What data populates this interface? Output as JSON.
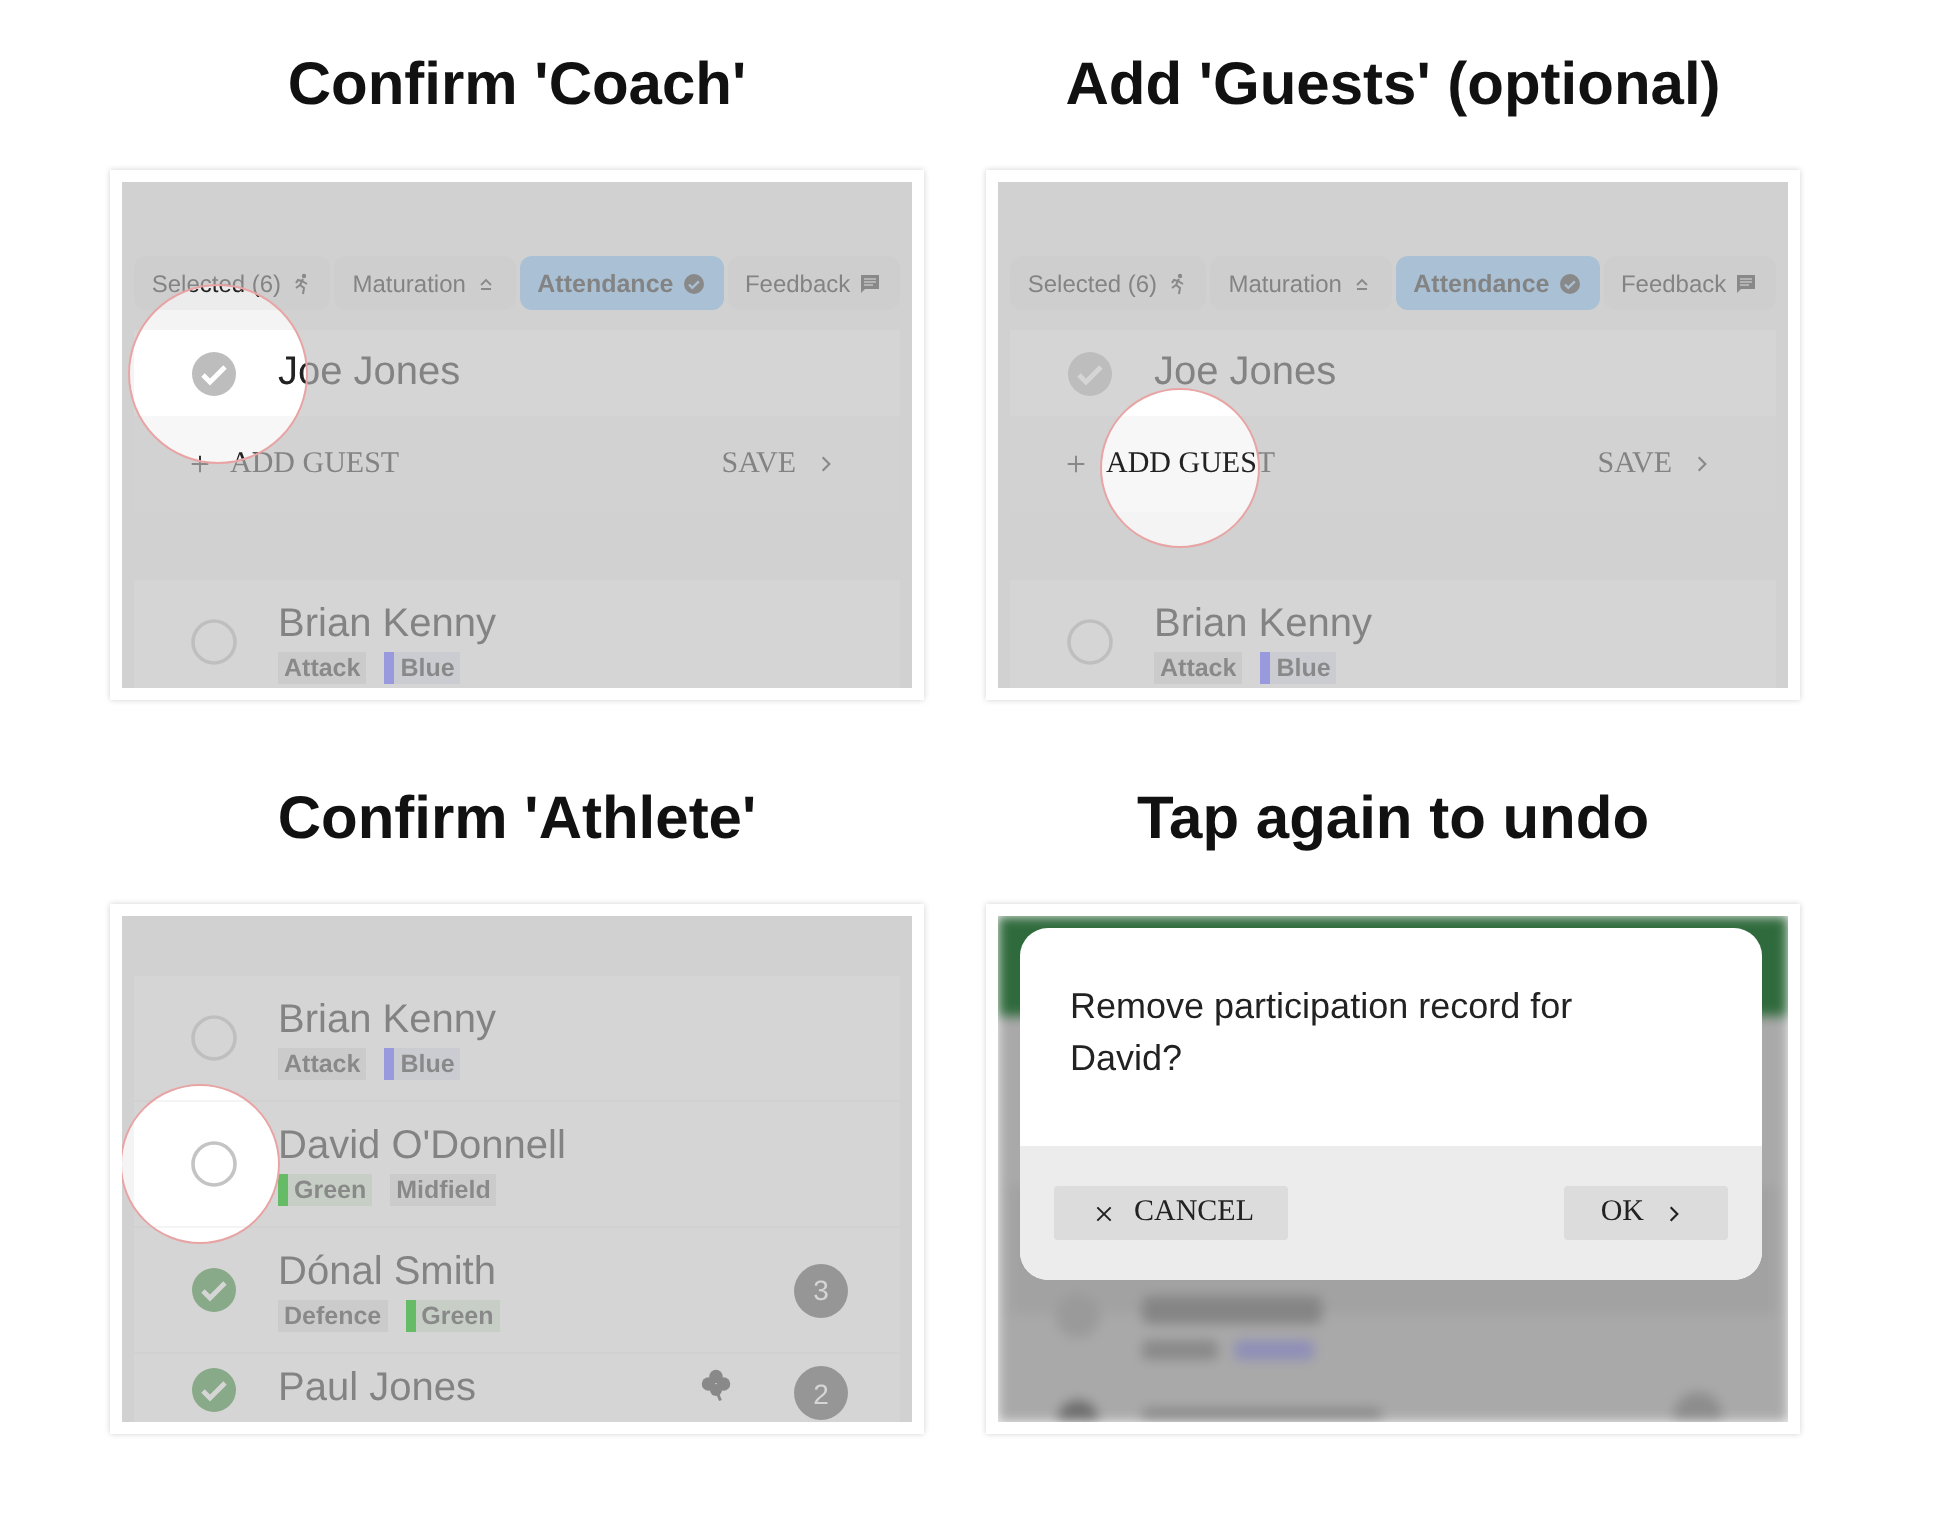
{
  "panels": [
    {
      "kind": "tabs-list",
      "title": "Confirm 'Coach'",
      "tabs": [
        {
          "label": "Selected (6)",
          "selected": false
        },
        {
          "label": "Maturation",
          "selected": false
        },
        {
          "label": "Attendance",
          "selected": true
        },
        {
          "label": "Feedback",
          "selected": false
        }
      ],
      "coach": {
        "name": "Joe Jones",
        "checked": true
      },
      "actions": [
        {
          "kind": "add",
          "label": "ADD GUEST"
        },
        {
          "kind": "save",
          "label": "SAVE"
        }
      ],
      "athletes": [
        {
          "name": "Brian Kenny",
          "checked": false,
          "tags": [
            {
              "label": "Attack"
            },
            {
              "label": "Blue",
              "color": "#9999dd"
            }
          ]
        }
      ]
    },
    {
      "kind": "tabs-list",
      "title": "Add 'Guests' (optional)",
      "tabs": [
        {
          "label": "Selected (6)",
          "selected": false
        },
        {
          "label": "Maturation",
          "selected": false
        },
        {
          "label": "Attendance",
          "selected": true
        },
        {
          "label": "Feedback",
          "selected": false
        }
      ],
      "coach": {
        "name": "Joe Jones",
        "checked": true
      },
      "actions": [
        {
          "kind": "add",
          "label": "ADD GUEST"
        },
        {
          "kind": "save",
          "label": "SAVE"
        }
      ],
      "athletes": [
        {
          "name": "Brian Kenny",
          "checked": false,
          "tags": [
            {
              "label": "Attack"
            },
            {
              "label": "Blue",
              "color": "#9999dd"
            }
          ]
        }
      ]
    },
    {
      "kind": "athlete-list",
      "title": "Confirm 'Athlete'",
      "athletes": [
        {
          "name": "Brian Kenny",
          "checked": false,
          "tags": [
            {
              "label": "Attack"
            },
            {
              "label": "Blue",
              "color": "#9999dd"
            }
          ]
        },
        {
          "name": "David O'Donnell",
          "checked": false,
          "tags": [
            {
              "label": "Green",
              "color": "#66bb66"
            },
            {
              "label": "Midfield"
            }
          ]
        },
        {
          "name": "Dónal Smith",
          "checked": true,
          "badge": "3",
          "tags": [
            {
              "label": "Defence"
            },
            {
              "label": "Green",
              "color": "#66bb66"
            }
          ]
        },
        {
          "name": "Paul Jones",
          "checked": true,
          "badge": "2",
          "has_icon": true
        }
      ]
    },
    {
      "kind": "dialog",
      "title": "Tap again to undo",
      "message": "Remove participation record for David?",
      "buttons": [
        {
          "kind": "cancel",
          "label": "CANCEL"
        },
        {
          "kind": "ok",
          "label": "OK"
        }
      ]
    }
  ]
}
